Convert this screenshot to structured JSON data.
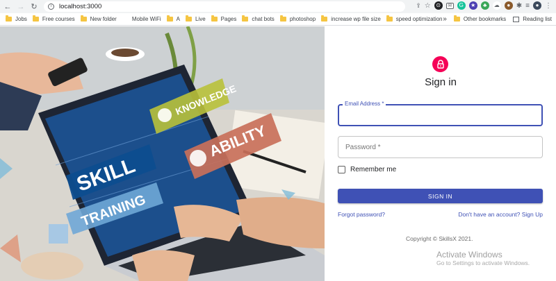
{
  "browser": {
    "url": "localhost:3000",
    "bookmarks": [
      "Jobs",
      "Free courses",
      "New folder",
      "Mobile WiFi",
      "A",
      "Live",
      "Pages",
      "chat bots",
      "photoshop",
      "increase wp file size",
      "speed optimization"
    ],
    "overflow": "»",
    "other_bookmarks": "Other bookmarks",
    "reading_list": "Reading list"
  },
  "hero": {
    "words": [
      "SKILL",
      "TRAINING",
      "KNOWLEDGE",
      "ABILITY"
    ]
  },
  "signin": {
    "title": "Sign in",
    "email_label": "Email Address *",
    "password_placeholder": "Password *",
    "remember_label": "Remember me",
    "button_label": "SIGN IN",
    "forgot_link": "Forgot password?",
    "signup_link": "Don't have an account? Sign Up",
    "copyright": "Copyright © SkillsX 2021."
  },
  "watermark": {
    "title": "Activate Windows",
    "subtitle": "Go to Settings to activate Windows."
  },
  "colors": {
    "primary": "#3f51b5",
    "avatar": "#f50057"
  }
}
